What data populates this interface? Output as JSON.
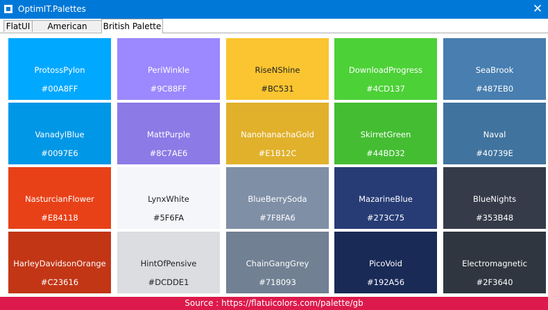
{
  "window": {
    "title": "OptimIT.Palettes",
    "close_glyph": "✕"
  },
  "tabs": [
    {
      "label": "FlatUI",
      "active": false
    },
    {
      "label": "American Palette",
      "active": false
    },
    {
      "label": "British Palette",
      "active": true
    }
  ],
  "swatches": [
    {
      "name": "ProtossPylon",
      "hex": "#00A8FF",
      "color": "#00a8ff"
    },
    {
      "name": "PeriWinkle",
      "hex": "#9C88FF",
      "color": "#9c88ff"
    },
    {
      "name": "RiseNShine",
      "hex": "#BC531",
      "color": "#fbc531"
    },
    {
      "name": "DownloadProgress",
      "hex": "#4CD137",
      "color": "#4cd137"
    },
    {
      "name": "SeaBrook",
      "hex": "#487EB0",
      "color": "#487eb0"
    },
    {
      "name": "VanadylBlue",
      "hex": "#0097E6",
      "color": "#0097e6"
    },
    {
      "name": "MattPurple",
      "hex": "#8C7AE6",
      "color": "#8c7ae6"
    },
    {
      "name": "NanohanachaGold",
      "hex": "#E1B12C",
      "color": "#e1b12c"
    },
    {
      "name": "SkirretGreen",
      "hex": "#44BD32",
      "color": "#44bd32"
    },
    {
      "name": "Naval",
      "hex": "#40739E",
      "color": "#40739e"
    },
    {
      "name": "NasturcianFlower",
      "hex": "#E84118",
      "color": "#e84118"
    },
    {
      "name": "LynxWhite",
      "hex": "#5F6FA",
      "color": "#f5f6fa"
    },
    {
      "name": "BlueBerrySoda",
      "hex": "#7F8FA6",
      "color": "#7f8fa6"
    },
    {
      "name": "MazarineBlue",
      "hex": "#273C75",
      "color": "#273c75"
    },
    {
      "name": "BlueNights",
      "hex": "#353B48",
      "color": "#353b48"
    },
    {
      "name": "HarleyDavidsonOrange",
      "hex": "#C23616",
      "color": "#c23616"
    },
    {
      "name": "HintOfPensive",
      "hex": "#DCDDE1",
      "color": "#dcdde1"
    },
    {
      "name": "ChainGangGrey",
      "hex": "#718093",
      "color": "#718093"
    },
    {
      "name": "PicoVoid",
      "hex": "#192A56",
      "color": "#192a56"
    },
    {
      "name": "Electromagnetic",
      "hex": "#2F3640",
      "color": "#2f3640"
    }
  ],
  "footer": {
    "text": "Source : https://flatuicolors.com/palette/gb"
  }
}
